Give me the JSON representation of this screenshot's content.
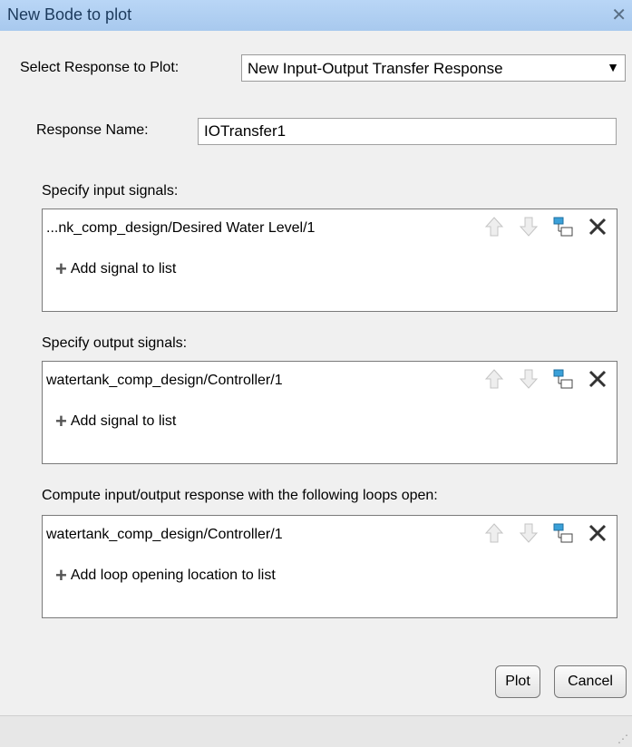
{
  "window": {
    "title": "New Bode to plot"
  },
  "select_response": {
    "label": "Select Response to Plot:",
    "value": "New Input-Output Transfer Response"
  },
  "response_name": {
    "label": "Response Name:",
    "value": "IOTransfer1"
  },
  "input_signals": {
    "label": "Specify input signals:",
    "items": [
      "...nk_comp_design/Desired  Water Level/1"
    ],
    "add_label": "Add signal to list"
  },
  "output_signals": {
    "label": "Specify output signals:",
    "items": [
      "watertank_comp_design/Controller/1"
    ],
    "add_label": "Add signal to list"
  },
  "loop_openings": {
    "label": "Compute input/output response with the following loops open:",
    "items": [
      "watertank_comp_design/Controller/1"
    ],
    "add_label": "Add loop opening location to list"
  },
  "buttons": {
    "plot": "Plot",
    "cancel": "Cancel"
  },
  "icons": [
    "move-up-icon",
    "move-down-icon",
    "select-from-model-icon",
    "delete-icon"
  ],
  "colors": {
    "titlebar": "#b9d6f6",
    "highlight": "#3aa0d8"
  }
}
